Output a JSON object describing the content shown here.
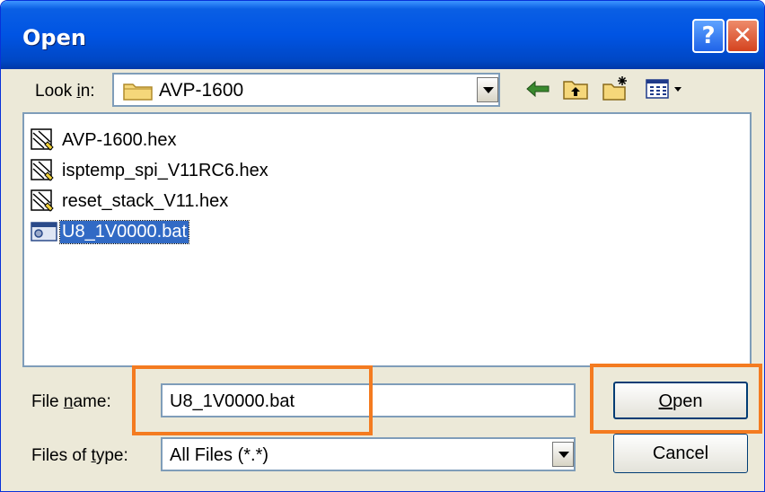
{
  "dialog": {
    "title": "Open",
    "help_glyph": "?",
    "close_glyph": "✕"
  },
  "lookin": {
    "label_prefix": "Look ",
    "label_accel": "i",
    "label_suffix": "n:",
    "value": "AVP-1600",
    "icon": "folder-icon"
  },
  "toolbar": {
    "icons": [
      "back-arrow-icon",
      "up-one-level-icon",
      "create-new-folder-icon",
      "view-menu-icon"
    ]
  },
  "files": [
    {
      "name": "AVP-1600.hex",
      "icon": "hex-file-icon",
      "selected": false
    },
    {
      "name": "isptemp_spi_V11RC6.hex",
      "icon": "hex-file-icon",
      "selected": false
    },
    {
      "name": "reset_stack_V11.hex",
      "icon": "hex-file-icon",
      "selected": false
    },
    {
      "name": "U8_1V0000.bat",
      "icon": "batch-file-icon",
      "selected": true
    }
  ],
  "filename": {
    "label_prefix": "File ",
    "label_accel": "n",
    "label_suffix": "ame:",
    "value": "U8_1V0000.bat"
  },
  "filetype": {
    "label_prefix": "Files of ",
    "label_accel": "t",
    "label_suffix": "ype:",
    "value": "All Files (*.*)"
  },
  "buttons": {
    "open_accel": "O",
    "open_rest": "pen",
    "cancel": "Cancel"
  },
  "colors": {
    "highlight": "#f47b20",
    "selection": "#316ac5",
    "titlebar": "#0054e3"
  }
}
